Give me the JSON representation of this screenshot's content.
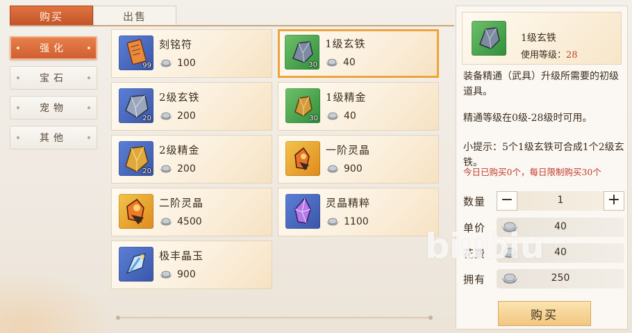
{
  "tabs": [
    {
      "label": "购买",
      "active": true
    },
    {
      "label": "出售",
      "active": false
    }
  ],
  "categories": [
    {
      "label": "强化",
      "active": true
    },
    {
      "label": "宝石",
      "active": false
    },
    {
      "label": "宠物",
      "active": false
    },
    {
      "label": "其他",
      "active": false
    }
  ],
  "items": [
    {
      "name": "刻铭符",
      "price": "100",
      "qty": "99",
      "icon": "scroll-icon"
    },
    {
      "name": "1级玄铁",
      "price": "40",
      "qty": "30",
      "icon": "iron-ore-icon",
      "selected": true
    },
    {
      "name": "2级玄铁",
      "price": "200",
      "qty": "20",
      "icon": "iron-ore-icon"
    },
    {
      "name": "1级精金",
      "price": "40",
      "qty": "30",
      "icon": "gold-ore-icon"
    },
    {
      "name": "2级精金",
      "price": "200",
      "qty": "20",
      "icon": "gold-ore-icon"
    },
    {
      "name": "一阶灵晶",
      "price": "900",
      "qty": "",
      "icon": "spirit-crystal-icon"
    },
    {
      "name": "二阶灵晶",
      "price": "4500",
      "qty": "",
      "icon": "spirit-crystal-icon"
    },
    {
      "name": "灵晶精粹",
      "price": "1100",
      "qty": "",
      "icon": "purple-crystal-icon"
    },
    {
      "name": "极丰晶玉",
      "price": "900",
      "qty": "",
      "icon": "jade-icon"
    }
  ],
  "detail": {
    "name": "1级玄铁",
    "level_label": "使用等级：",
    "level_value": "28",
    "desc1": "装备精通（武具）升级所需要的初级道具。",
    "desc2": "精通等级在0级-28级时可用。",
    "desc3": "小提示：5个1级玄铁可合成1个2级玄铁。",
    "limit_note": "今日已购买0个，每日限制购买30个",
    "quantity_label": "数量",
    "quantity": "1",
    "minus": "−",
    "plus": "+",
    "unit_price_label": "单价",
    "unit_price": "40",
    "cost_label": "花费",
    "cost": "40",
    "owned_label": "拥有",
    "owned": "250",
    "buy_label": "购买"
  },
  "watermark": "biubiu",
  "colors": {
    "accent": "#d0602f",
    "selected_border": "#f0a33a",
    "warning": "#c0392b"
  }
}
